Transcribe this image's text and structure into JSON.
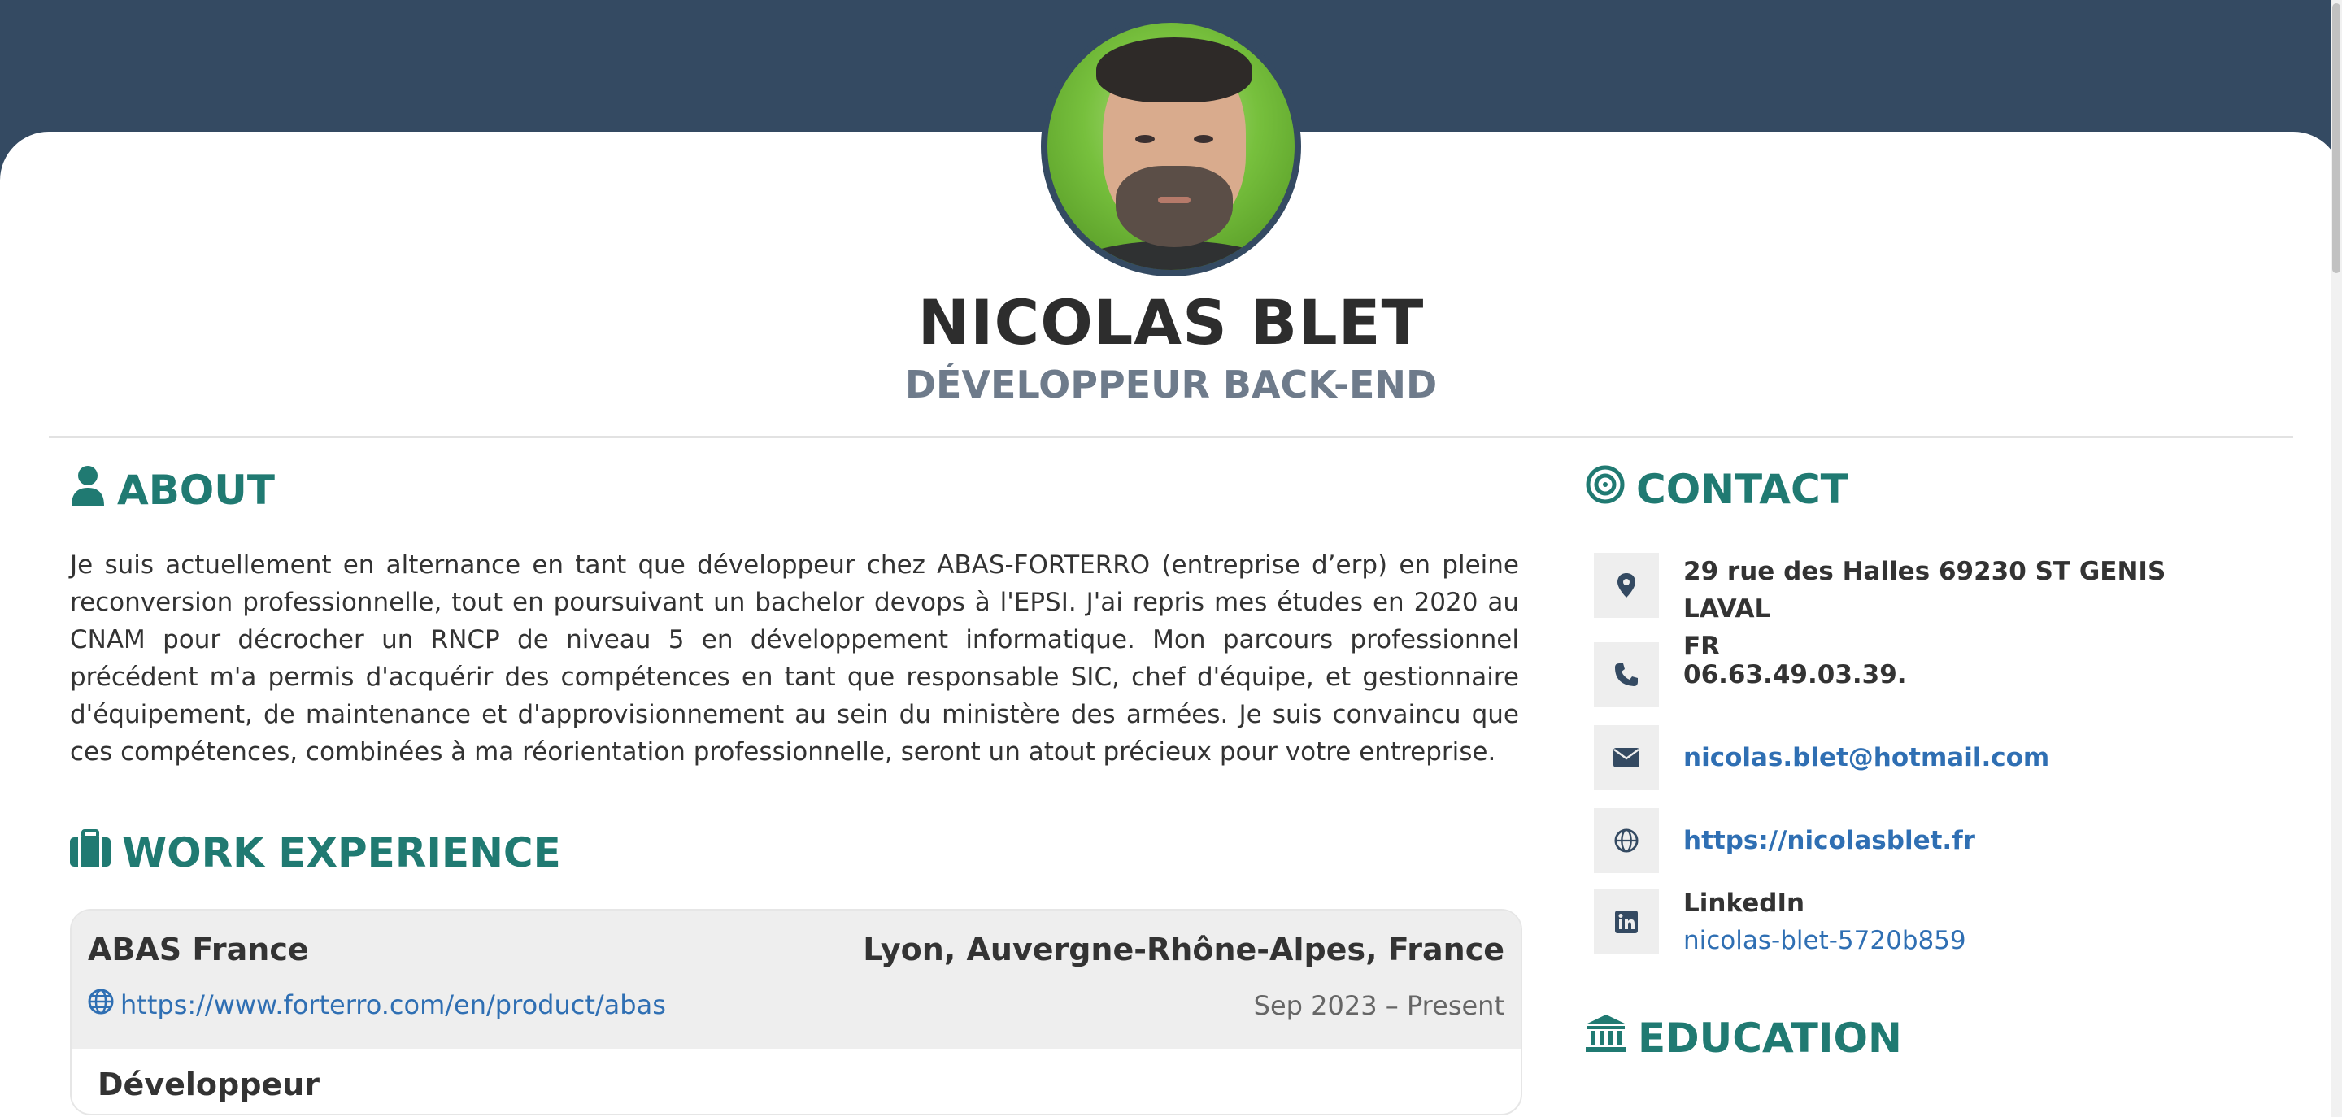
{
  "profile": {
    "name": "NICOLAS BLET",
    "role": "DÉVELOPPEUR BACK-END"
  },
  "about": {
    "title": "ABOUT",
    "text": "Je suis actuellement en alternance en tant que développeur chez ABAS-FORTERRO (entreprise d’erp) en pleine reconversion professionnelle, tout en poursuivant un bachelor devops à l'EPSI. J'ai repris mes études en 2020 au CNAM pour décrocher un RNCP de niveau 5 en développement informatique. Mon parcours professionnel précédent m'a permis d'acquérir des compétences en tant que responsable SIC, chef d'équipe, et gestionnaire d'équipement, de maintenance et d'approvisionnement au sein du ministère des armées. Je suis convaincu que ces compétences, combinées à ma réorientation professionnelle, seront un atout précieux pour votre entreprise."
  },
  "work": {
    "title": "WORK EXPERIENCE",
    "jobs": [
      {
        "company": "ABAS France",
        "location": "Lyon, Auvergne-Rhône-Alpes, France",
        "url": "https://www.forterro.com/en/product/abas",
        "dates": "Sep 2023 – Present",
        "position": "Développeur"
      }
    ]
  },
  "contact": {
    "title": "CONTACT",
    "address_line1": "29 rue des Halles 69230 ST GENIS LAVAL",
    "address_line2": "FR",
    "phone": "06.63.49.03.39.",
    "email": "nicolas.blet@hotmail.com",
    "website": "https://nicolasblet.fr",
    "linkedin_label": "LinkedIn",
    "linkedin_handle": "nicolas-blet-5720b859"
  },
  "education": {
    "title": "EDUCATION"
  },
  "icons": {
    "about": "user-icon",
    "work": "briefcase-icon",
    "contact": "bullseye-icon",
    "education": "university-icon",
    "address": "map-marker-icon",
    "phone": "phone-icon",
    "email": "envelope-icon",
    "website": "globe-icon",
    "linkedin": "linkedin-icon"
  },
  "colors": {
    "header_bg": "#344a62",
    "accent": "#207a72",
    "link": "#2f6fb3"
  }
}
